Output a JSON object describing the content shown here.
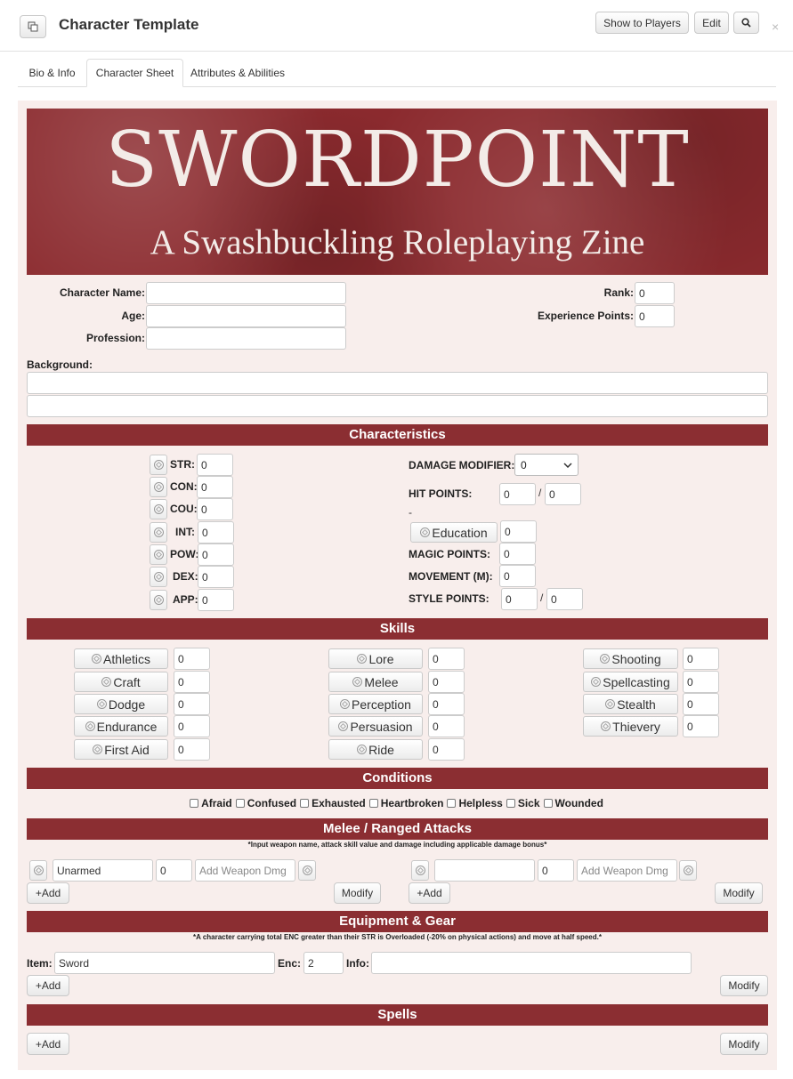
{
  "header": {
    "title": "Character Template",
    "show_players_label": "Show to Players",
    "edit_label": "Edit",
    "close_glyph": "×"
  },
  "tabs": [
    {
      "label": "Bio & Info"
    },
    {
      "label": "Character Sheet"
    },
    {
      "label": "Attributes & Abilities"
    }
  ],
  "banner": {
    "title": "SWORDPOINT",
    "subtitle": "A Swashbuckling Roleplaying Zine"
  },
  "bio": {
    "character_name_label": "Character Name:",
    "age_label": "Age:",
    "profession_label": "Profession:",
    "rank_label": "Rank:",
    "rank_value": "0",
    "xp_label": "Experience Points:",
    "xp_value": "0",
    "background_label": "Background:"
  },
  "sections": {
    "characteristics": "Characteristics",
    "skills": "Skills",
    "conditions": "Conditions",
    "attacks": "Melee / Ranged Attacks",
    "attacks_note": "*Input weapon name, attack skill value and damage including applicable damage bonus*",
    "equipment": "Equipment & Gear",
    "equipment_note": "*A character carrying total ENC greater than their STR is Overloaded (-20% on physical actions) and move at half speed.*",
    "spells": "Spells"
  },
  "characteristics": [
    {
      "label": "STR:",
      "value": "0"
    },
    {
      "label": "CON:",
      "value": "0"
    },
    {
      "label": "COU:",
      "value": "0"
    },
    {
      "label": "INT:",
      "value": "0"
    },
    {
      "label": "POW:",
      "value": "0"
    },
    {
      "label": "DEX:",
      "value": "0"
    },
    {
      "label": "APP:",
      "value": "0"
    }
  ],
  "derived": {
    "damage_modifier_label": "DAMAGE MODIFIER:",
    "damage_modifier_value": "0",
    "hit_points_label": "HIT POINTS:",
    "hit_points_current": "0",
    "hit_points_max": "0",
    "dash": "-",
    "education_label": "Education",
    "education_value": "0",
    "magic_points_label": "MAGIC POINTS:",
    "magic_points_value": "0",
    "movement_label": "MOVEMENT (M):",
    "movement_value": "0",
    "style_points_label": "STYLE POINTS:",
    "style_points_current": "0",
    "style_points_max": "0",
    "slash": "/"
  },
  "skills": {
    "col1": [
      {
        "label": "Athletics",
        "value": "0"
      },
      {
        "label": "Craft",
        "value": "0"
      },
      {
        "label": "Dodge",
        "value": "0"
      },
      {
        "label": "Endurance",
        "value": "0"
      },
      {
        "label": "First Aid",
        "value": "0"
      }
    ],
    "col2": [
      {
        "label": "Lore",
        "value": "0"
      },
      {
        "label": "Melee",
        "value": "0"
      },
      {
        "label": "Perception",
        "value": "0"
      },
      {
        "label": "Persuasion",
        "value": "0"
      },
      {
        "label": "Ride",
        "value": "0"
      }
    ],
    "col3": [
      {
        "label": "Shooting",
        "value": "0"
      },
      {
        "label": "Spellcasting",
        "value": "0"
      },
      {
        "label": "Stealth",
        "value": "0"
      },
      {
        "label": "Thievery",
        "value": "0"
      }
    ]
  },
  "conditions": [
    "Afraid",
    "Confused",
    "Exhausted",
    "Heartbroken",
    "Helpless",
    "Sick",
    "Wounded"
  ],
  "attacks": [
    {
      "name": "Unarmed",
      "skill": "0",
      "damage_placeholder": "Add Weapon Dmg"
    },
    {
      "name": "",
      "skill": "0",
      "damage_placeholder": "Add Weapon Dmg"
    }
  ],
  "buttons": {
    "add": "+Add",
    "modify": "Modify"
  },
  "equipment": {
    "item_label": "Item:",
    "item_value": "Sword",
    "enc_label": "Enc:",
    "enc_value": "2",
    "info_label": "Info:",
    "info_value": ""
  },
  "colors": {
    "accent": "#8b2e32",
    "sheet_bg": "#f8eeec"
  }
}
